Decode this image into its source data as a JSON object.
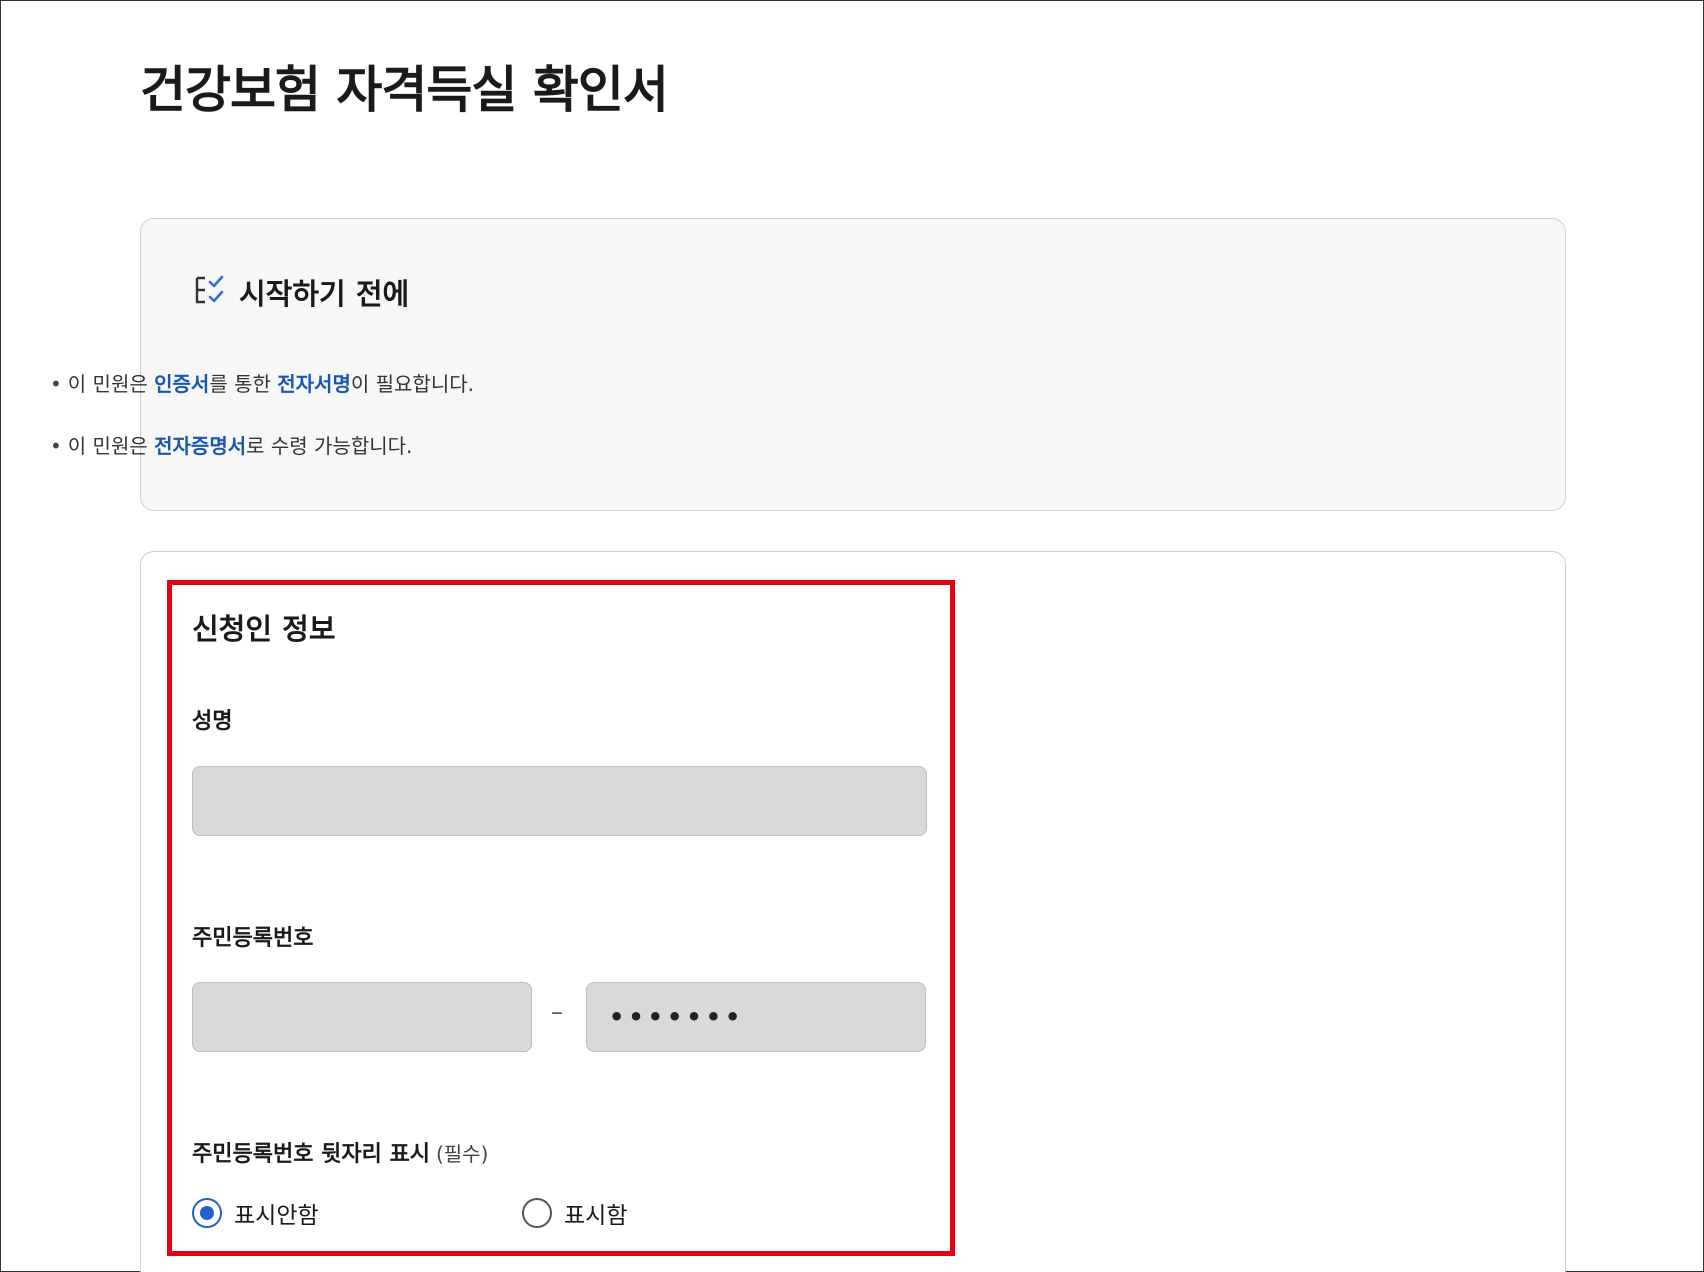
{
  "page": {
    "title": "건강보험 자격득실 확인서"
  },
  "notice": {
    "icon": "checklist-icon",
    "title": "시작하기 전에",
    "line1": {
      "bullet": "•",
      "prefix": "이 민원은 ",
      "hl1": "인증서",
      "mid": "를 통한 ",
      "hl2": "전자서명",
      "suffix": "이 필요합니다."
    },
    "line2": {
      "bullet": "•",
      "prefix": "이 민원은 ",
      "hl1": "전자증명서",
      "suffix": "로 수령 가능합니다."
    }
  },
  "applicant": {
    "section_title": "신청인 정보",
    "name_label": "성명",
    "name_value": "",
    "rrn_label": "주민등록번호",
    "rrn_front_value": "",
    "rrn_dash": "–",
    "rrn_back_value": "•••••••",
    "display_label": "주민등록번호 뒷자리 표시",
    "display_required": "(필수)",
    "display_options": [
      {
        "label": "표시안함",
        "selected": true
      },
      {
        "label": "표시함",
        "selected": false
      }
    ]
  },
  "colors": {
    "highlight_text": "#1a56b0",
    "annotation_border": "#e60012",
    "radio_selected": "#2460c8",
    "input_bg": "#d9d9d9"
  }
}
